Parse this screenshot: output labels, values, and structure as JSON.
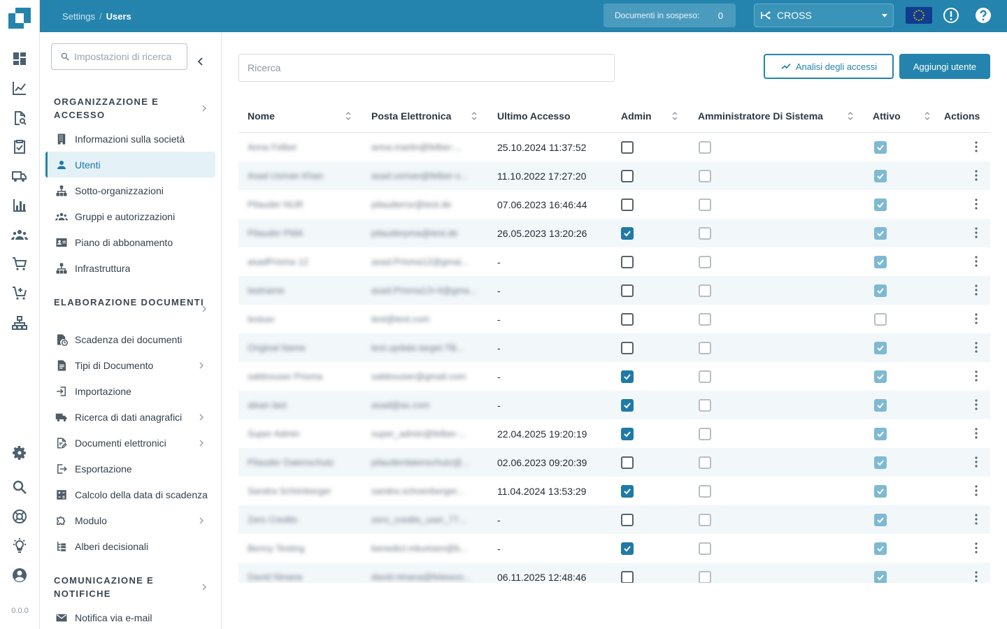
{
  "app": {
    "version": "0.0.0"
  },
  "breadcrumb": {
    "parent": "Settings",
    "current": "Users"
  },
  "topbar": {
    "pending_label": "Documenti in sospeso:",
    "pending_count": "0",
    "tenant": "CROSS",
    "flag_icon": "eu-flag-icon",
    "info_icon": "alert-circle-icon",
    "help_icon": "help-icon"
  },
  "rail": {
    "icons": [
      "dashboard-icon",
      "chart-line-icon",
      "document-search-icon",
      "clipboard-check-icon",
      "truck-icon",
      "bar-chart-icon",
      "people-icon",
      "cart-icon",
      "cart-add-icon",
      "sitemap-icon",
      "settings-icon",
      "search-icon",
      "support-icon",
      "lightbulb-icon",
      "account-icon"
    ]
  },
  "sidebar": {
    "search_placeholder": "Impostazioni di ricerca",
    "sections": [
      {
        "title": "Organizzazione e accesso",
        "items": [
          {
            "label": "Informazioni sulla società",
            "icon": "building-icon"
          },
          {
            "label": "Utenti",
            "icon": "user-icon",
            "active": true
          },
          {
            "label": "Sotto-organizzazioni",
            "icon": "hierarchy-icon"
          },
          {
            "label": "Gruppi e autorizzazioni",
            "icon": "group-icon"
          },
          {
            "label": "Piano di abbonamento",
            "icon": "id-card-icon"
          },
          {
            "label": "Infrastruttura",
            "icon": "hierarchy-icon"
          }
        ]
      },
      {
        "title": "Elaborazione documenti",
        "items": [
          {
            "label": "Scadenza dei documenti",
            "icon": "document-clock-icon"
          },
          {
            "label": "Tipi di Documento",
            "icon": "document-icon",
            "has_children": true
          },
          {
            "label": "Importazione",
            "icon": "import-icon"
          },
          {
            "label": "Ricerca di dati anagrafici",
            "icon": "truck-icon",
            "has_children": true
          },
          {
            "label": "Documenti elettronici",
            "icon": "document-edit-icon",
            "has_children": true
          },
          {
            "label": "Esportazione",
            "icon": "export-icon"
          },
          {
            "label": "Calcolo della data di scadenza",
            "icon": "calculator-icon"
          },
          {
            "label": "Modulo",
            "icon": "puzzle-icon",
            "has_children": true
          },
          {
            "label": "Alberi decisionali",
            "icon": "tree-icon"
          }
        ]
      },
      {
        "title": "Comunicazione e notifiche",
        "items": [
          {
            "label": "Notifica via e-mail",
            "icon": "mail-icon"
          }
        ]
      }
    ]
  },
  "main": {
    "search_placeholder": "Ricerca",
    "analytics_button": "Analisi degli accessi",
    "add_button": "Aggiungi utente"
  },
  "table": {
    "columns": [
      "Nome",
      "Posta Elettronica",
      "Ultimo Accesso",
      "Admin",
      "Amministratore Di Sistema",
      "Attivo",
      "Actions"
    ],
    "rows": [
      {
        "name": "Anna Felber",
        "email": "anna.martin@felber-...",
        "last": "25.10.2024 11:37:52",
        "admin": false,
        "sysadmin": false,
        "active": true
      },
      {
        "name": "Asad Usman Khan",
        "email": "asad.usman@felber-s...",
        "last": "11.10.2022 17:27:20",
        "admin": false,
        "sysadmin": false,
        "active": true
      },
      {
        "name": "Pilauder NUR",
        "email": "pilauderror@test.de",
        "last": "07.06.2023 16:46:44",
        "admin": false,
        "sysadmin": false,
        "active": true
      },
      {
        "name": "Pilauder PMA",
        "email": "pilauderpma@test.de",
        "last": "26.05.2023 13:20:26",
        "admin": true,
        "sysadmin": false,
        "active": true
      },
      {
        "name": "asadPrisma 12",
        "email": "asad.Prisma12@gmai...",
        "last": "-",
        "admin": false,
        "sysadmin": false,
        "active": true
      },
      {
        "name": "lastname",
        "email": "asad.Prisma13+4@gma...",
        "last": "-",
        "admin": false,
        "sysadmin": false,
        "active": true
      },
      {
        "name": "testusr",
        "email": "test@test.com",
        "last": "-",
        "admin": false,
        "sysadmin": false,
        "active": false
      },
      {
        "name": "Original Name",
        "email": "test.update.target.TB...",
        "last": "-",
        "admin": false,
        "sysadmin": false,
        "active": true
      },
      {
        "name": "saldovuser Prisma",
        "email": "saldovuser@gmail.com",
        "last": "-",
        "admin": true,
        "sysadmin": false,
        "active": true
      },
      {
        "name": "alean last",
        "email": "asad@ax.com",
        "last": "-",
        "admin": true,
        "sysadmin": false,
        "active": true
      },
      {
        "name": "Super Admin",
        "email": "super_admin@felber-...",
        "last": "22.04.2025 19:20:19",
        "admin": true,
        "sysadmin": false,
        "active": true
      },
      {
        "name": "Pilauder Datenschutz",
        "email": "pilauderdatenschutz@...",
        "last": "02.06.2023 09:20:39",
        "admin": false,
        "sysadmin": false,
        "active": true
      },
      {
        "name": "Sandra Schönberger",
        "email": "sandra.schoenberger...",
        "last": "11.04.2024 13:53:29",
        "admin": true,
        "sysadmin": false,
        "active": true
      },
      {
        "name": "Zero Credits",
        "email": "zero_credits_user_77...",
        "last": "-",
        "admin": false,
        "sysadmin": false,
        "active": true
      },
      {
        "name": "Benny Testing",
        "email": "benedict.mkurtsen@b...",
        "last": "-",
        "admin": true,
        "sysadmin": false,
        "active": true
      },
      {
        "name": "David Ninana",
        "email": "david.ninana@felewoo...",
        "last": "06.11.2025 12:48:46",
        "admin": false,
        "sysadmin": false,
        "active": true
      }
    ]
  },
  "colors": {
    "primary": "#2484ad",
    "topbar": "#2484ad",
    "checked": "#1f7aa6",
    "row_alt": "#f2f7fa"
  }
}
